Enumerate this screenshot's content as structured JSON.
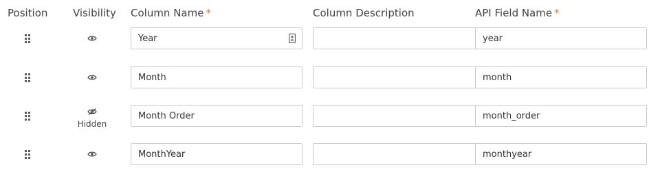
{
  "headers": {
    "position": "Position",
    "visibility": "Visibility",
    "column_name": "Column Name",
    "column_description": "Column Description",
    "api_field_name": "API Field Name",
    "required_marker": "*"
  },
  "colors": {
    "required": "#e8772e",
    "field_border": "#c9c9c9",
    "icon": "#555555"
  },
  "rows": [
    {
      "column_name": "Year",
      "column_description": "",
      "api_field_name": "year",
      "visible": true,
      "visibility_icon": "eye-icon",
      "field_icon": "contact-card-icon"
    },
    {
      "column_name": "Month",
      "column_description": "",
      "api_field_name": "month",
      "visible": true,
      "visibility_icon": "eye-icon"
    },
    {
      "column_name": "Month Order",
      "column_description": "",
      "api_field_name": "month_order",
      "visible": false,
      "visibility_icon": "eye-slash-icon",
      "visibility_label": "Hidden"
    },
    {
      "column_name": "MonthYear",
      "column_description": "",
      "api_field_name": "monthyear",
      "visible": true,
      "visibility_icon": "eye-icon"
    }
  ]
}
